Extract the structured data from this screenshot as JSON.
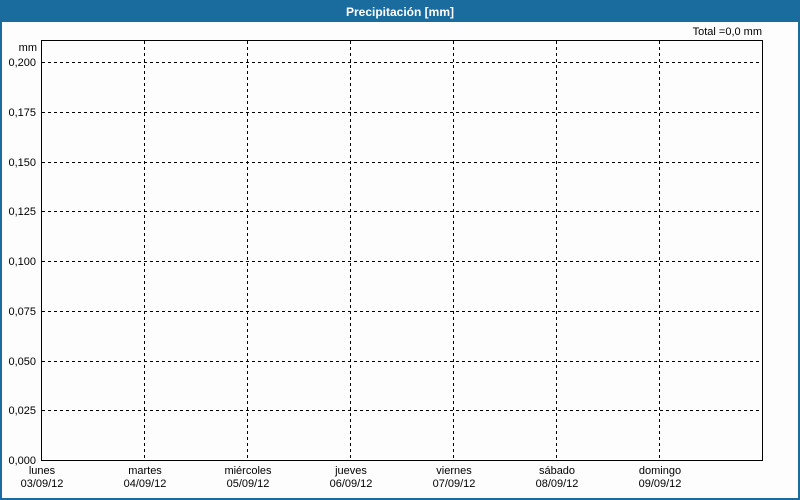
{
  "header": {
    "title": "Precipitación [mm]",
    "total": "Total =0,0 mm"
  },
  "colors": {
    "accent": "#1a6b9e",
    "title_text": "#ffffff",
    "grid": "#000000",
    "plot_border": "#000000",
    "background": "#fdfdfd"
  },
  "y_axis": {
    "unit": "mm",
    "ticks": [
      "0,200",
      "0,175",
      "0,150",
      "0,125",
      "0,100",
      "0,075",
      "0,050",
      "0,025",
      "0,000"
    ]
  },
  "x_axis": {
    "days": [
      {
        "day": "lunes",
        "date": "03/09/12"
      },
      {
        "day": "martes",
        "date": "04/09/12"
      },
      {
        "day": "miércoles",
        "date": "05/09/12"
      },
      {
        "day": "jueves",
        "date": "06/09/12"
      },
      {
        "day": "viernes",
        "date": "07/09/12"
      },
      {
        "day": "sábado",
        "date": "08/09/12"
      },
      {
        "day": "domingo",
        "date": "09/09/12"
      }
    ]
  },
  "chart_data": {
    "type": "bar",
    "title": "Precipitación [mm]",
    "categories": [
      "03/09/12",
      "04/09/12",
      "05/09/12",
      "06/09/12",
      "07/09/12",
      "08/09/12",
      "09/09/12"
    ],
    "category_day_names": [
      "lunes",
      "martes",
      "miércoles",
      "jueves",
      "viernes",
      "sábado",
      "domingo"
    ],
    "values": [
      0,
      0,
      0,
      0,
      0,
      0,
      0
    ],
    "total_label": "Total =0,0 mm",
    "total_mm": 0.0,
    "xlabel": "",
    "ylabel": "mm",
    "ylim": [
      0,
      0.2
    ],
    "ytick_step": 0.025,
    "grid": "dashed",
    "legend": "none"
  }
}
